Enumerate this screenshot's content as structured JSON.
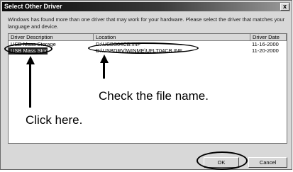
{
  "dialog": {
    "title": "Select Other Driver",
    "close_glyph": "x",
    "message": "Windows has found more than one driver that may work for your hardware. Please select the driver that matches your language and device."
  },
  "list": {
    "columns": [
      "Driver Description",
      "Location",
      "Driver Date"
    ],
    "rows": [
      {
        "description": "USB Mass Storage",
        "location": "D:\\USBS04CB.INF",
        "date": "11-16-2000"
      },
      {
        "description": "USB Mass Storage",
        "location": "D:\\USBDRV\\WINME\\UFLT04CB.INF",
        "date": "11-20-2000"
      }
    ]
  },
  "annotations": {
    "check_file": "Check the file name.",
    "click_here": "Click here."
  },
  "buttons": {
    "ok": "OK",
    "cancel": "Cancel"
  }
}
